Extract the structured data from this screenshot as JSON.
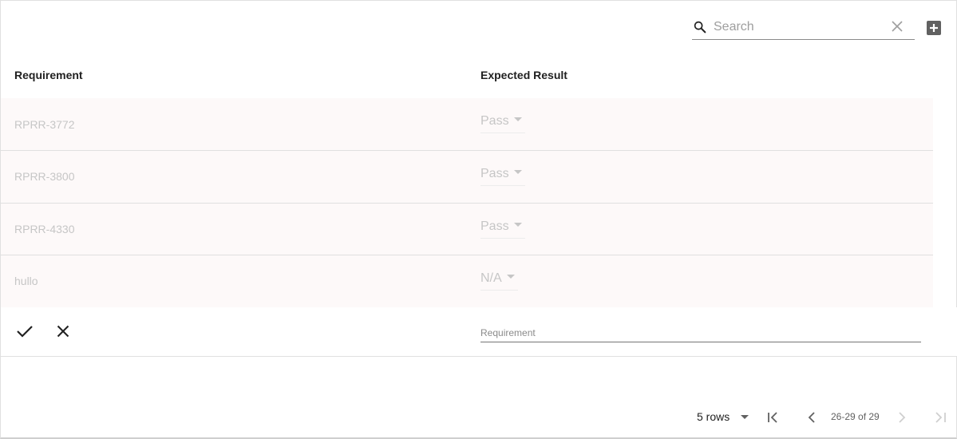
{
  "search": {
    "placeholder": "Search",
    "value": ""
  },
  "columns": {
    "requirement": "Requirement",
    "expected_result": "Expected Result"
  },
  "rows": [
    {
      "requirement": "RPRR-3772",
      "expected_result": "Pass"
    },
    {
      "requirement": "RPRR-3800",
      "expected_result": "Pass"
    },
    {
      "requirement": "RPRR-4330",
      "expected_result": "Pass"
    },
    {
      "requirement": "hullo",
      "expected_result": "N/A"
    }
  ],
  "edit_row": {
    "placeholder": "Requirement",
    "value": ""
  },
  "pagination": {
    "rows_per_page": "5 rows",
    "range": "26-29 of 29"
  },
  "icons": {
    "search": "search-icon",
    "clear": "close-icon",
    "add": "add-box-icon",
    "save": "check-icon",
    "cancel": "close-icon",
    "first": "first-page-icon",
    "prev": "chevron-left-icon",
    "next": "chevron-right-icon",
    "last": "last-page-icon"
  },
  "colors": {
    "row_background": "#fdf9f9",
    "disabled_text": "#c6c6c6",
    "header_text": "#212121"
  }
}
